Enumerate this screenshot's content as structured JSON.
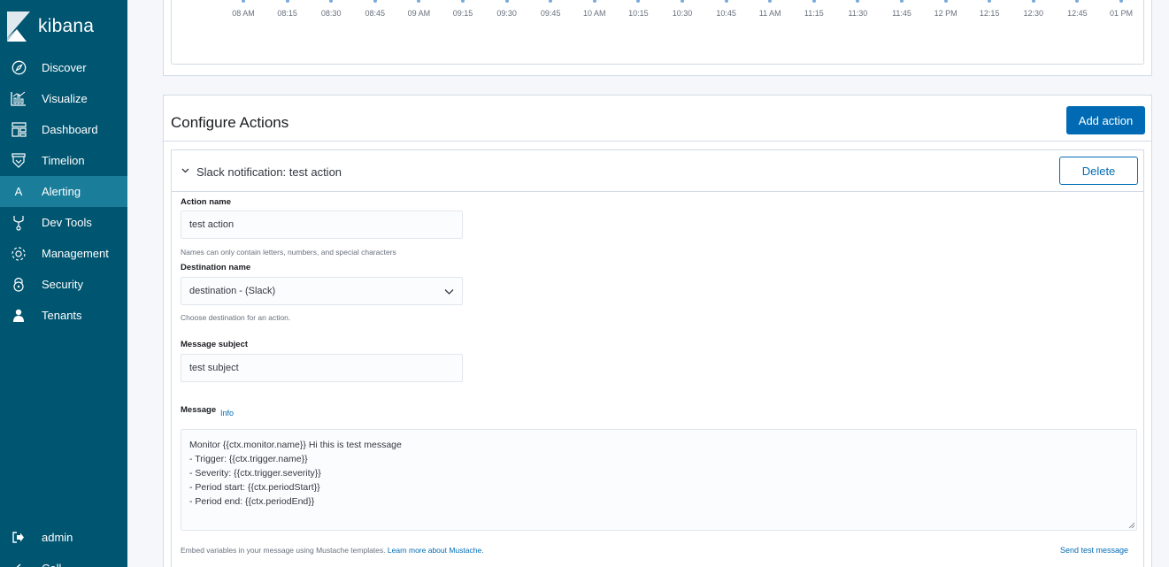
{
  "app": {
    "name": "kibana"
  },
  "sidebar": {
    "items": [
      {
        "label": "Discover",
        "icon": "compass-icon"
      },
      {
        "label": "Visualize",
        "icon": "chart-icon"
      },
      {
        "label": "Dashboard",
        "icon": "dashboard-icon"
      },
      {
        "label": "Timelion",
        "icon": "shield-icon"
      },
      {
        "label": "Alerting",
        "icon": "a-letter-icon",
        "icon_glyph": "A",
        "active": true
      },
      {
        "label": "Dev Tools",
        "icon": "wrench-icon"
      },
      {
        "label": "Management",
        "icon": "gear-icon"
      },
      {
        "label": "Security",
        "icon": "lock-icon"
      },
      {
        "label": "Tenants",
        "icon": "user-icon"
      }
    ],
    "bottom": [
      {
        "label": "admin",
        "icon": "logout-icon"
      },
      {
        "label": "Coll",
        "icon": "collapse-icon"
      }
    ]
  },
  "chart": {
    "x_ticks": [
      "08 AM",
      "08:15",
      "08:30",
      "08:45",
      "09 AM",
      "09:15",
      "09:30",
      "09:45",
      "10 AM",
      "10:15",
      "10:30",
      "10:45",
      "11 AM",
      "11:15",
      "11:30",
      "11:45",
      "12 PM",
      "12:15",
      "12:30",
      "12:45",
      "01 PM"
    ]
  },
  "actions": {
    "title": "Configure Actions",
    "add_button": "Add action",
    "card": {
      "title": "Slack notification: test action",
      "delete_button": "Delete",
      "action_name_label": "Action name",
      "action_name_value": "test action",
      "action_name_help": "Names can only contain letters, numbers, and special characters",
      "destination_label": "Destination name",
      "destination_value": "destination - (Slack)",
      "destination_help": "Choose destination for an action.",
      "subject_label": "Message subject",
      "subject_value": "test subject",
      "message_label": "Message",
      "info_link": "Info",
      "message_lines": [
        "Monitor {{ctx.monitor.name}} Hi this is test message",
        "- Trigger: {{ctx.trigger.name}}",
        "- Severity: {{ctx.trigger.severity}}",
        "- Period start: {{ctx.periodStart}}",
        "- Period end: {{ctx.periodEnd}}"
      ],
      "embed_help": "Embed variables in your message using Mustache templates.",
      "mustache_link": "Learn more about Mustache.",
      "send_test": "Send test message"
    }
  },
  "colors": {
    "sidebar": "#005571",
    "active": "#1a7d99",
    "accent": "#006bb4"
  }
}
